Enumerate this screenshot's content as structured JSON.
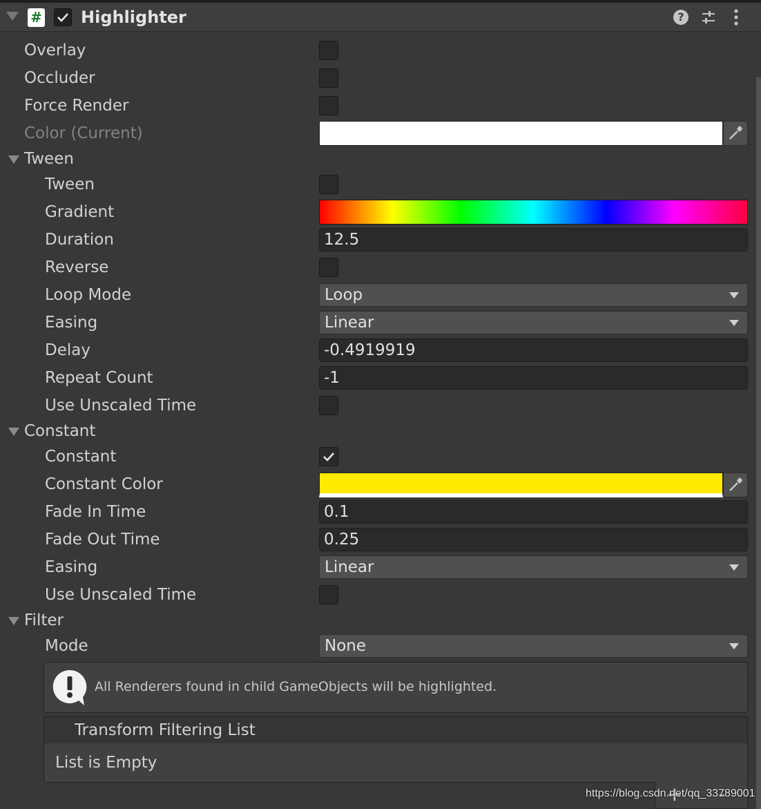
{
  "header": {
    "title": "Highlighter",
    "script_icon_glyph": "#",
    "enabled": true,
    "icons": [
      "help-icon",
      "preset-icon",
      "menu-icon"
    ]
  },
  "fields": {
    "overlay": {
      "label": "Overlay",
      "checked": false
    },
    "occluder": {
      "label": "Occluder",
      "checked": false
    },
    "force_render": {
      "label": "Force Render",
      "checked": false
    },
    "color_current": {
      "label": "Color (Current)",
      "color": "#ffffff"
    }
  },
  "tween": {
    "section_label": "Tween",
    "tween": {
      "label": "Tween",
      "checked": false
    },
    "gradient": {
      "label": "Gradient"
    },
    "duration": {
      "label": "Duration",
      "value": "12.5"
    },
    "reverse": {
      "label": "Reverse",
      "checked": false
    },
    "loop_mode": {
      "label": "Loop Mode",
      "value": "Loop"
    },
    "easing": {
      "label": "Easing",
      "value": "Linear"
    },
    "delay": {
      "label": "Delay",
      "value": "-0.4919919"
    },
    "repeat_count": {
      "label": "Repeat Count",
      "value": "-1"
    },
    "use_unscaled_time": {
      "label": "Use Unscaled Time",
      "checked": false
    }
  },
  "constant": {
    "section_label": "Constant",
    "constant": {
      "label": "Constant",
      "checked": true
    },
    "constant_color": {
      "label": "Constant Color",
      "color": "#ffeb00"
    },
    "fade_in_time": {
      "label": "Fade In Time",
      "value": "0.1"
    },
    "fade_out_time": {
      "label": "Fade Out Time",
      "value": "0.25"
    },
    "easing": {
      "label": "Easing",
      "value": "Linear"
    },
    "use_unscaled_time": {
      "label": "Use Unscaled Time",
      "checked": false
    }
  },
  "filter": {
    "section_label": "Filter",
    "mode": {
      "label": "Mode",
      "value": "None"
    },
    "help_text": "All Renderers found in child GameObjects will be highlighted.",
    "list_title": "Transform Filtering List",
    "list_empty": "List is Empty",
    "add_glyph": "+",
    "remove_glyph": "-"
  },
  "watermark": "https://blog.csdn.net/qq_33789001",
  "colors": {
    "background": "#383838",
    "field": "#2a2a2a",
    "dropdown": "#505050",
    "text": "#d2d2d2"
  }
}
